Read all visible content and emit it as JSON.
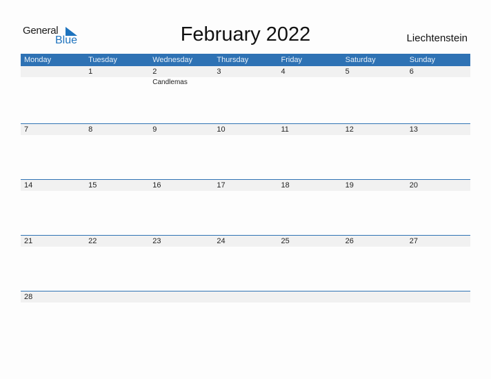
{
  "brand": {
    "line1": "General",
    "line2": "Blue",
    "icon": "triangle-flag-icon",
    "color": "#1e73be"
  },
  "title": "February 2022",
  "country": "Liechtenstein",
  "colors": {
    "header_bg": "#2e72b4",
    "row_band": "#f1f1f1"
  },
  "days": [
    "Monday",
    "Tuesday",
    "Wednesday",
    "Thursday",
    "Friday",
    "Saturday",
    "Sunday"
  ],
  "weeks": [
    [
      {
        "d": ""
      },
      {
        "d": "1"
      },
      {
        "d": "2",
        "holiday": "Candlemas"
      },
      {
        "d": "3"
      },
      {
        "d": "4"
      },
      {
        "d": "5"
      },
      {
        "d": "6"
      }
    ],
    [
      {
        "d": "7"
      },
      {
        "d": "8"
      },
      {
        "d": "9"
      },
      {
        "d": "10"
      },
      {
        "d": "11"
      },
      {
        "d": "12"
      },
      {
        "d": "13"
      }
    ],
    [
      {
        "d": "14"
      },
      {
        "d": "15"
      },
      {
        "d": "16"
      },
      {
        "d": "17"
      },
      {
        "d": "18"
      },
      {
        "d": "19"
      },
      {
        "d": "20"
      }
    ],
    [
      {
        "d": "21"
      },
      {
        "d": "22"
      },
      {
        "d": "23"
      },
      {
        "d": "24"
      },
      {
        "d": "25"
      },
      {
        "d": "26"
      },
      {
        "d": "27"
      }
    ],
    [
      {
        "d": "28"
      },
      {
        "d": ""
      },
      {
        "d": ""
      },
      {
        "d": ""
      },
      {
        "d": ""
      },
      {
        "d": ""
      },
      {
        "d": ""
      }
    ]
  ]
}
